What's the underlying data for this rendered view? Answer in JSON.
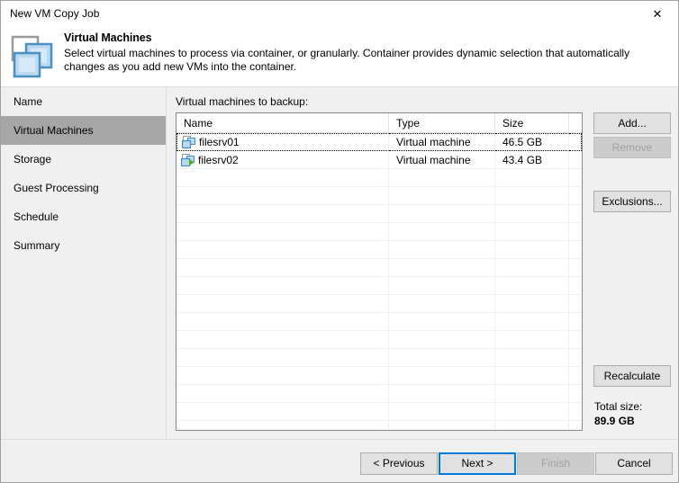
{
  "window": {
    "title": "New VM Copy Job",
    "close_label": "✕"
  },
  "header": {
    "icon": "virtual-machines-icon",
    "title": "Virtual Machines",
    "description": "Select virtual machines to process via container, or granularly. Container provides dynamic selection that automatically changes as you add new VMs into the container."
  },
  "sidebar": {
    "items": [
      {
        "label": "Name",
        "selected": false
      },
      {
        "label": "Virtual Machines",
        "selected": true
      },
      {
        "label": "Storage",
        "selected": false
      },
      {
        "label": "Guest Processing",
        "selected": false
      },
      {
        "label": "Schedule",
        "selected": false
      },
      {
        "label": "Summary",
        "selected": false
      }
    ]
  },
  "main": {
    "list_label": "Virtual machines to backup:",
    "table": {
      "columns": [
        "Name",
        "Type",
        "Size",
        ""
      ],
      "rows": [
        {
          "name": "filesrv01",
          "type": "Virtual machine",
          "size": "46.5 GB",
          "icon": "vm-icon",
          "focused": true
        },
        {
          "name": "filesrv02",
          "type": "Virtual machine",
          "size": "43.4 GB",
          "icon": "vm-running-icon",
          "focused": false
        }
      ],
      "empty_row_count": 15
    },
    "side_buttons": {
      "add": "Add...",
      "remove": "Remove",
      "exclusions": "Exclusions...",
      "recalculate": "Recalculate"
    },
    "total_size_label": "Total size:",
    "total_size_value": "89.9 GB"
  },
  "footer": {
    "previous": "< Previous",
    "next": "Next >",
    "finish": "Finish",
    "cancel": "Cancel"
  },
  "colors": {
    "accent": "#0078d7",
    "icon_blue": "#4a90c2",
    "icon_fill": "#bcd9ef",
    "selected_nav": "#a6a6a6",
    "running_green": "#4caf2f"
  }
}
